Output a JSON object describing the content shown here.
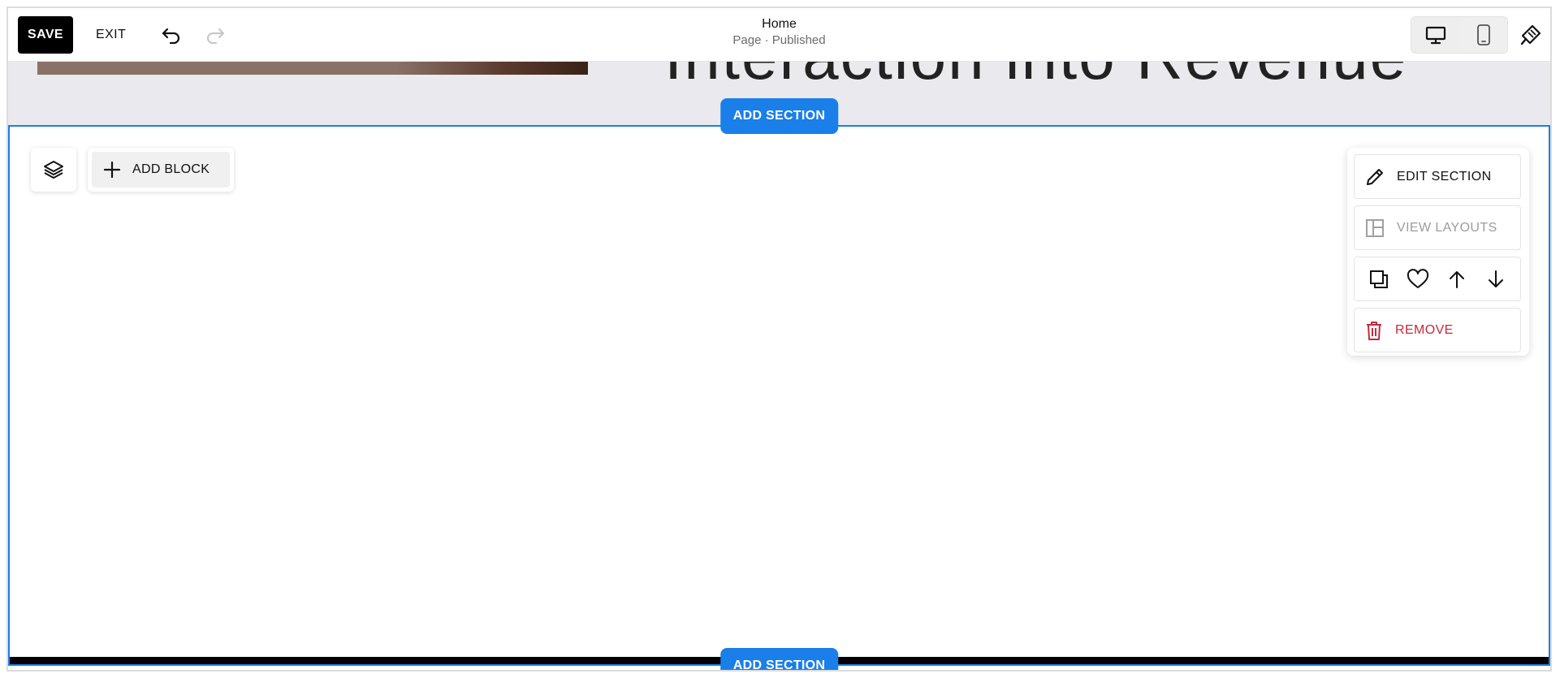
{
  "toolbar": {
    "save_label": "SAVE",
    "exit_label": "EXIT"
  },
  "page": {
    "title": "Home",
    "subtitle": "Page · Published"
  },
  "preview": {
    "heading": "Interaction into Revenue"
  },
  "section": {
    "add_section_label": "ADD SECTION",
    "add_block_label": "ADD BLOCK"
  },
  "edit_panel": {
    "edit_section_label": "EDIT SECTION",
    "view_layouts_label": "VIEW LAYOUTS",
    "remove_label": "REMOVE"
  },
  "colors": {
    "accent": "#1a7fe8",
    "danger": "#c62a3a",
    "disabled": "#9c9c9c"
  },
  "icons": [
    "undo-icon",
    "redo-icon",
    "desktop-icon",
    "mobile-icon",
    "paintbrush-icon",
    "layers-icon",
    "plus-icon",
    "pencil-icon",
    "layout-icon",
    "duplicate-icon",
    "heart-icon",
    "arrow-up-icon",
    "arrow-down-icon",
    "trash-icon"
  ]
}
